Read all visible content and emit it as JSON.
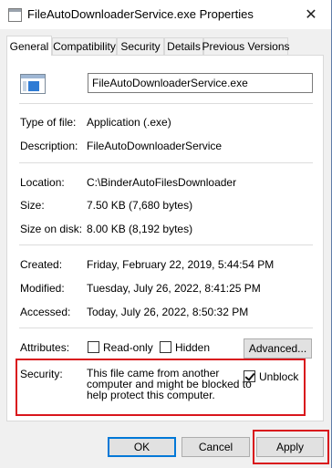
{
  "window": {
    "title": "FileAutoDownloaderService.exe Properties",
    "close_glyph": "✕"
  },
  "tabs": [
    {
      "label": "General",
      "active": true
    },
    {
      "label": "Compatibility",
      "active": false
    },
    {
      "label": "Security",
      "active": false
    },
    {
      "label": "Details",
      "active": false
    },
    {
      "label": "Previous Versions",
      "active": false
    }
  ],
  "general": {
    "file_name": "FileAutoDownloaderService.exe",
    "type_label": "Type of file:",
    "type_value": "Application (.exe)",
    "description_label": "Description:",
    "description_value": "FileAutoDownloaderService",
    "location_label": "Location:",
    "location_value": "C:\\BinderAutoFilesDownloader",
    "size_label": "Size:",
    "size_value": "7.50 KB (7,680 bytes)",
    "size_on_disk_label": "Size on disk:",
    "size_on_disk_value": "8.00 KB (8,192 bytes)",
    "created_label": "Created:",
    "created_value": "Friday, February 22, 2019, 5:44:54 PM",
    "modified_label": "Modified:",
    "modified_value": "Tuesday, July 26, 2022, 8:41:25 PM",
    "accessed_label": "Accessed:",
    "accessed_value": "Today, July 26, 2022, 8:50:32 PM",
    "attributes_label": "Attributes:",
    "readonly_label": "Read-only",
    "readonly_checked": false,
    "hidden_label": "Hidden",
    "hidden_checked": false,
    "advanced_label": "Advanced...",
    "security_label": "Security:",
    "security_text_1": "This file came from another",
    "security_text_2": "computer and might be blocked to",
    "security_text_3": "help protect this computer.",
    "unblock_label": "Unblock",
    "unblock_checked": true
  },
  "buttons": {
    "ok": "OK",
    "cancel": "Cancel",
    "apply": "Apply"
  },
  "highlight_color": "#d9161c",
  "accent_color": "#0078d7"
}
